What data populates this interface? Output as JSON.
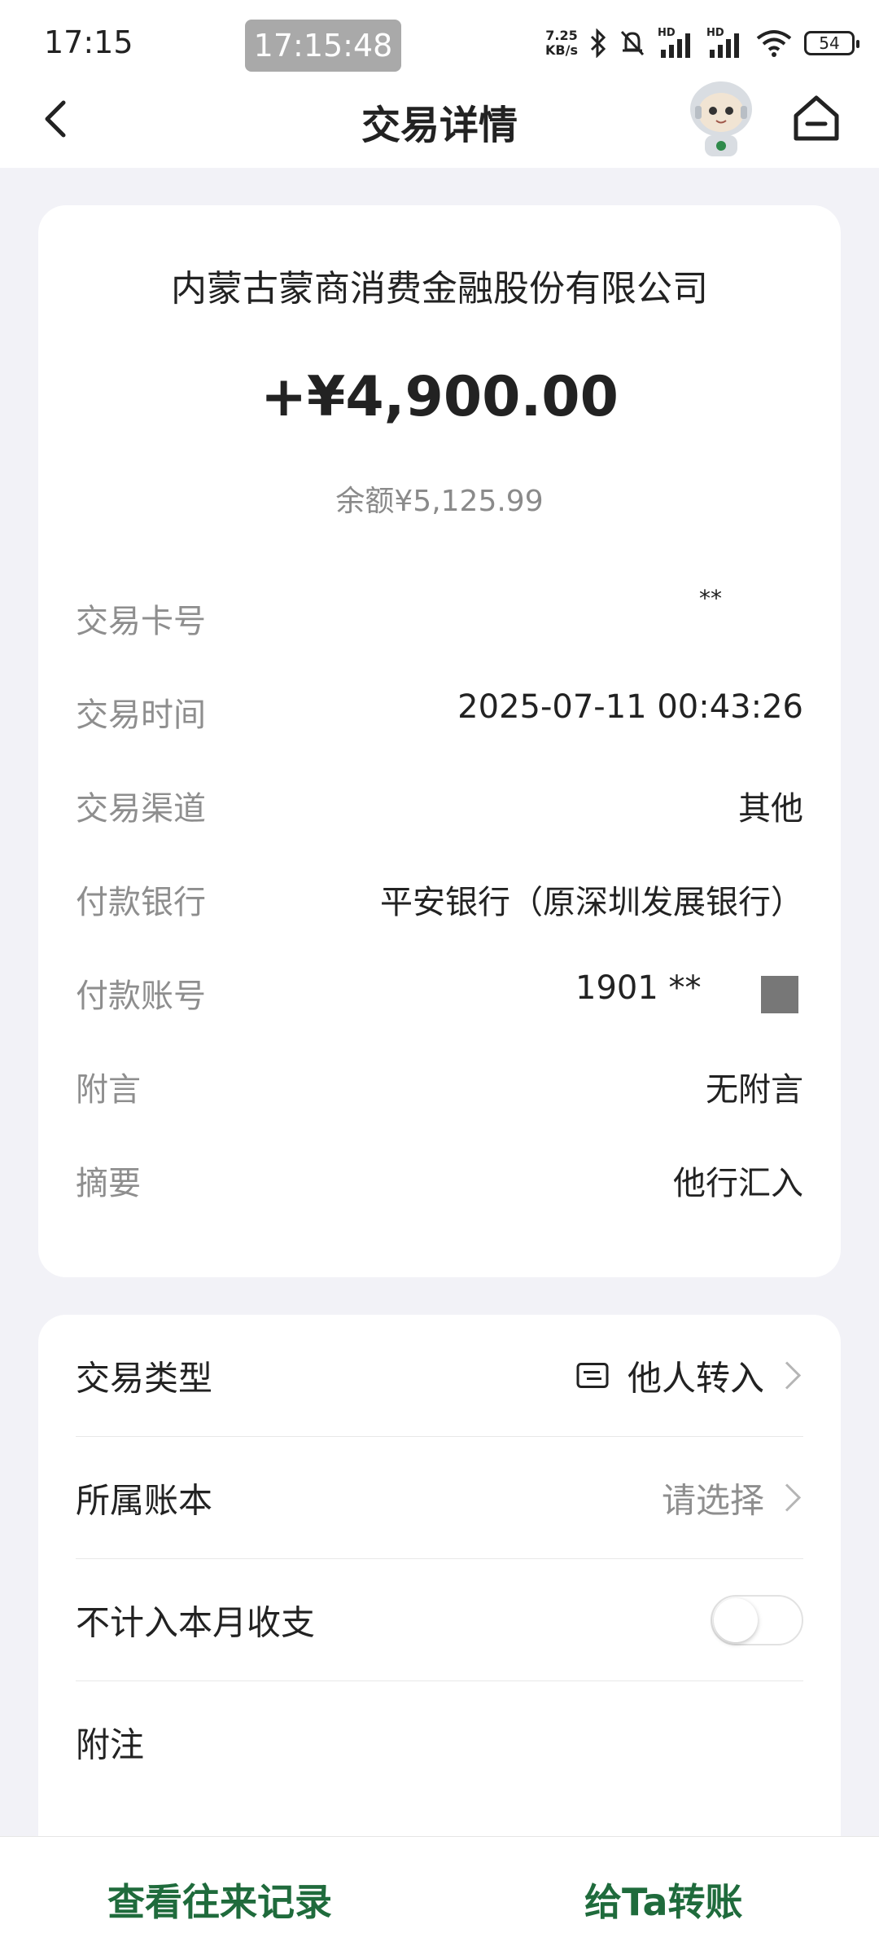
{
  "status_bar": {
    "time": "17:15",
    "timer": "17:15:48",
    "net_speed_value": "7.25",
    "net_speed_unit": "KB/s",
    "signal_tag": "HD",
    "battery": "54"
  },
  "nav": {
    "title": "交易详情"
  },
  "summary": {
    "counterparty": "内蒙古蒙商消费金融股份有限公司",
    "amount": "+¥4,900.00",
    "balance": "余额¥5,125.99"
  },
  "details": {
    "card_no_label": "交易卡号",
    "card_no_value": "**",
    "time_label": "交易时间",
    "time_value": "2025-07-11 00:43:26",
    "channel_label": "交易渠道",
    "channel_value": "其他",
    "payer_bank_label": "付款银行",
    "payer_bank_value": "平安银行（原深圳发展银行）",
    "payer_account_label": "付款账号",
    "payer_account_value": "1901 **",
    "message_label": "附言",
    "message_value": "无附言",
    "summary_label": "摘要",
    "summary_value": "他行汇入"
  },
  "settings": {
    "type_label": "交易类型",
    "type_value": "他人转入",
    "ledger_label": "所属账本",
    "ledger_value": "请选择",
    "exclude_label": "不计入本月收支",
    "exclude_on": false,
    "note_label": "附注"
  },
  "bottom": {
    "history_label": "查看往来记录",
    "transfer_label": "给Ta转账"
  },
  "colors": {
    "brand_green": "#1f6b3c",
    "page_bg": "#f2f2f7",
    "label_grey": "#8e8e8e"
  }
}
